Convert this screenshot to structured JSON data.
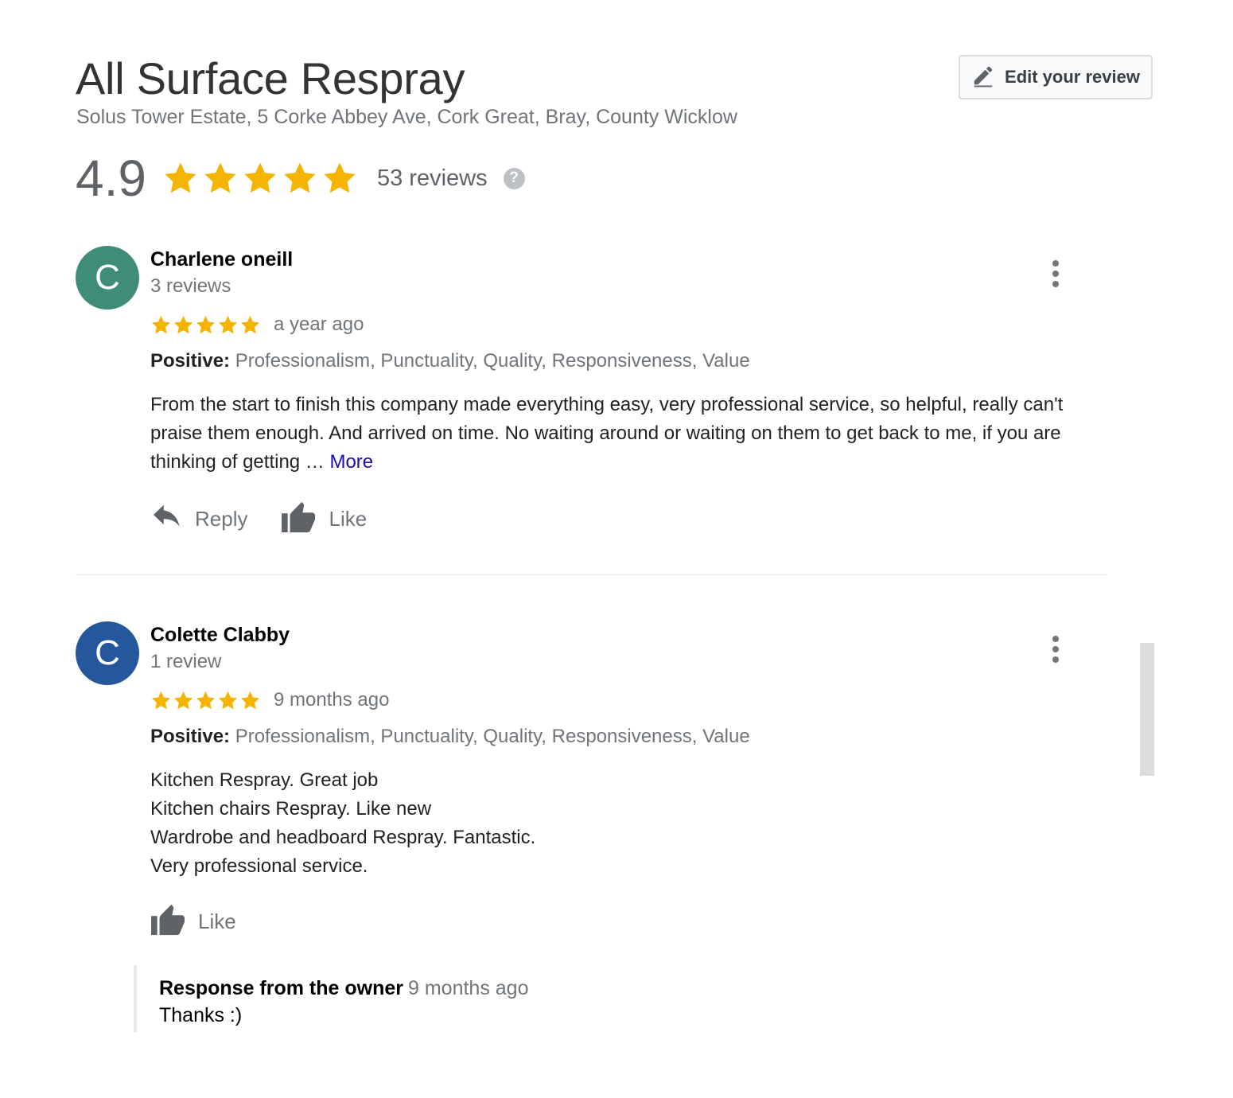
{
  "business": {
    "name": "All Surface Respray",
    "address": "Solus Tower Estate, 5 Corke Abbey Ave, Cork Great, Bray, County Wicklow",
    "edit_review_label": "Edit your review",
    "rating": "4.9",
    "rating_stars": 5,
    "review_count": "53 reviews",
    "help_glyph": "?"
  },
  "colors": {
    "star": "#f4b400",
    "avatar_1": "#3f8c79",
    "avatar_2": "#24579c",
    "link": "#1a0dab"
  },
  "icons": {
    "edit": "pencil-icon",
    "reply": "reply-arrow-icon",
    "like": "thumbs-up-icon",
    "menu": "kebab-menu-icon",
    "help": "help-circle-icon"
  },
  "reviews": [
    {
      "avatar_letter": "C",
      "name": "Charlene oneill",
      "count": "3 reviews",
      "stars": 5,
      "time": "a year ago",
      "positive_label": "Positive:",
      "positive_items": " Professionalism, Punctuality, Quality, Responsiveness, Value",
      "text": "From the start to finish this company made everything easy, very professional service, so helpful, really can't praise them enough. And arrived on time. No waiting around or waiting on them to get back to me, if you are thinking of getting … ",
      "more_label": "More",
      "reply_label": "Reply",
      "like_label": "Like"
    },
    {
      "avatar_letter": "C",
      "name": "Colette Clabby",
      "count": "1 review",
      "stars": 5,
      "time": "9 months ago",
      "positive_label": "Positive:",
      "positive_items": " Professionalism, Punctuality, Quality, Responsiveness, Value",
      "text_lines": [
        "Kitchen Respray. Great job",
        "Kitchen chairs Respray. Like new",
        "Wardrobe and headboard Respray. Fantastic.",
        "Very professional service."
      ],
      "like_label": "Like",
      "owner_response": {
        "label": "Response from the owner",
        "time": "9 months ago",
        "text": "Thanks :)"
      }
    }
  ]
}
